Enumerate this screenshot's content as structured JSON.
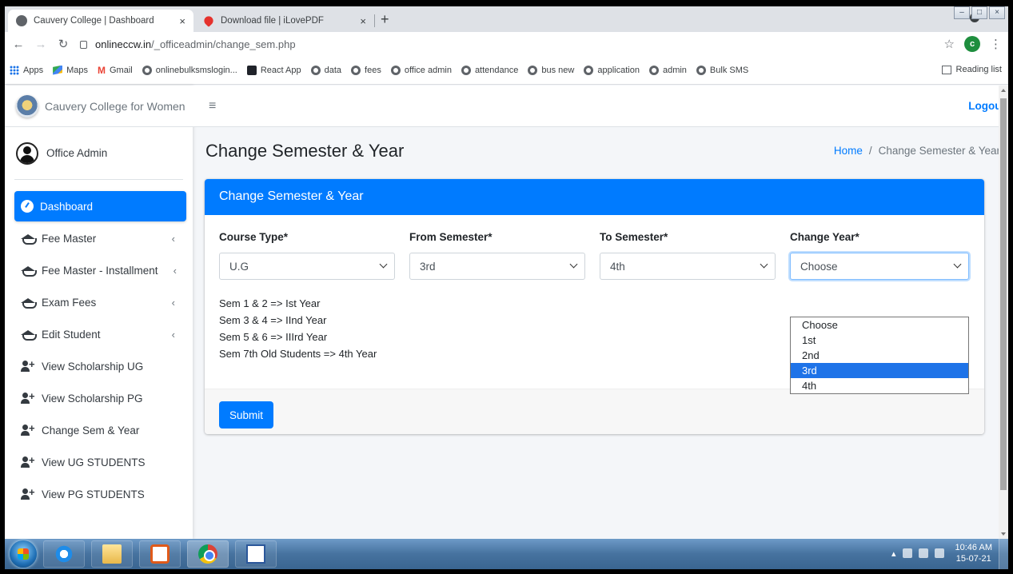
{
  "browser": {
    "tabs": [
      {
        "title": "Cauvery College | Dashboard",
        "close": "×",
        "active": true
      },
      {
        "title": "Download file | iLovePDF",
        "close": "×",
        "active": false
      }
    ],
    "new_tab": "+",
    "url_host": "onlineccw.in",
    "url_path": "/_officeadmin/change_sem.php",
    "profile_initial": "c",
    "bookmarks": [
      "Apps",
      "Maps",
      "Gmail",
      "onlinebulksmslogin...",
      "React App",
      "data",
      "fees",
      "office admin",
      "attendance",
      "bus new",
      "application",
      "admin",
      "Bulk SMS"
    ],
    "reading_list": "Reading list"
  },
  "sidebar": {
    "brand": "Cauvery College for Women",
    "user": "Office Admin",
    "items": [
      {
        "label": "Dashboard",
        "icon": "gauge-icon",
        "active": true
      },
      {
        "label": "Fee Master",
        "icon": "graduation-cap-icon",
        "chevron": "‹"
      },
      {
        "label": "Fee Master - Installment",
        "icon": "graduation-cap-icon",
        "chevron": "‹"
      },
      {
        "label": "Exam Fees",
        "icon": "graduation-cap-icon",
        "chevron": "‹"
      },
      {
        "label": "Edit Student",
        "icon": "graduation-cap-icon",
        "chevron": "‹"
      },
      {
        "label": "View Scholarship UG",
        "icon": "user-plus-icon"
      },
      {
        "label": "View Scholarship PG",
        "icon": "user-plus-icon"
      },
      {
        "label": "Change Sem & Year",
        "icon": "user-plus-icon"
      },
      {
        "label": "View UG STUDENTS",
        "icon": "user-plus-icon"
      },
      {
        "label": "View PG STUDENTS",
        "icon": "user-plus-icon"
      }
    ]
  },
  "navbar": {
    "hamburger": "≡",
    "logout": "Logout"
  },
  "header": {
    "title": "Change Semester & Year",
    "breadcrumb_home": "Home",
    "breadcrumb_sep": "/",
    "breadcrumb_current": "Change Semester & Year"
  },
  "card": {
    "title": "Change Semester & Year",
    "fields": {
      "course_type": {
        "label": "Course Type*",
        "value": "U.G"
      },
      "from_sem": {
        "label": "From Semester*",
        "value": "3rd"
      },
      "to_sem": {
        "label": "To Semester*",
        "value": "4th"
      },
      "change_year": {
        "label": "Change Year*",
        "value": "Choose"
      }
    },
    "info_lines": [
      "Sem 1 & 2 => Ist Year",
      "Sem 3 & 4 => IInd Year",
      "Sem 5 & 6 => IIIrd Year",
      "Sem 7th Old Students => 4th Year"
    ],
    "year_options": [
      "Choose",
      "1st",
      "2nd",
      "3rd",
      "4th"
    ],
    "highlighted_option": "3rd",
    "submit": "Submit"
  },
  "taskbar": {
    "time": "10:46 AM",
    "date": "15-07-21"
  },
  "colors": {
    "primary": "#007bff",
    "highlight": "#1e73e8"
  }
}
